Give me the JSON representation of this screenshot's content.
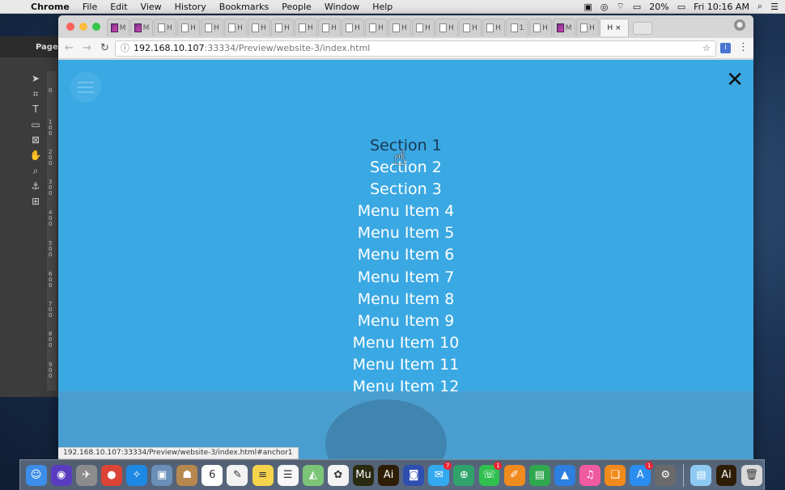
{
  "menubar": {
    "app": "Chrome",
    "items": [
      "File",
      "Edit",
      "View",
      "History",
      "Bookmarks",
      "People",
      "Window",
      "Help"
    ],
    "battery": "20%",
    "clock": "Fri 10:16 AM"
  },
  "photoshop": {
    "page_label": "Page:",
    "ruler_ticks": [
      "0",
      "1\n0\n0",
      "2\n0\n0",
      "3\n0\n0",
      "4\n0\n0",
      "5\n0\n0",
      "6\n0\n0",
      "7\n0\n0",
      "8\n0\n0",
      "9\n0\n0"
    ]
  },
  "browser": {
    "tabs": [
      "M",
      "M",
      "H",
      "H",
      "H",
      "H",
      "H",
      "H",
      "H",
      "H",
      "H",
      "H",
      "H",
      "H",
      "H",
      "H",
      "H",
      "1",
      "H",
      "M",
      "H"
    ],
    "active_tab": "H",
    "url_host": "192.168.10.107",
    "url_rest": ":33334/Preview/website-3/index.html",
    "status_url": "192.168.10.107:33334/Preview/website-3/index.html#anchor1"
  },
  "page": {
    "close_glyph": "✕",
    "menu_items": [
      "Section 1",
      "Section 2",
      "Section 3",
      "Menu Item 4",
      "Menu Item 5",
      "Menu Item 6",
      "Menu Item 7",
      "Menu Item 8",
      "Menu Item 9",
      "Menu Item 10",
      "Menu Item 11",
      "Menu Item 12"
    ],
    "hovered_item": "Section 1"
  },
  "dock": {
    "calendar_day": "6",
    "apps": [
      {
        "name": "finder",
        "glyph": "☺",
        "color": "#3d8ee8"
      },
      {
        "name": "siri",
        "glyph": "◉",
        "color": "#5a3dbf"
      },
      {
        "name": "launchpad",
        "glyph": "✈",
        "color": "#8c8c8c"
      },
      {
        "name": "chrome",
        "glyph": "●",
        "color": "#db4437"
      },
      {
        "name": "safari",
        "glyph": "✧",
        "color": "#1e88e5"
      },
      {
        "name": "preview",
        "glyph": "▣",
        "color": "#6a8fb8"
      },
      {
        "name": "contacts",
        "glyph": "☗",
        "color": "#b6874e"
      },
      {
        "name": "calendar",
        "glyph": "6",
        "color": "#ffffff"
      },
      {
        "name": "textedit",
        "glyph": "✎",
        "color": "#f2f2f2"
      },
      {
        "name": "notes",
        "glyph": "≡",
        "color": "#f5d34b"
      },
      {
        "name": "reminders",
        "glyph": "☰",
        "color": "#f7f7f7"
      },
      {
        "name": "maps",
        "glyph": "◭",
        "color": "#7cc576"
      },
      {
        "name": "photos",
        "glyph": "✿",
        "color": "#f3f3f3"
      },
      {
        "name": "muse",
        "glyph": "Mu",
        "color": "#2a2a10"
      },
      {
        "name": "illustrator",
        "glyph": "Ai",
        "color": "#2e1d05"
      },
      {
        "name": "photo-booth",
        "glyph": "◙",
        "color": "#2f4fb0"
      },
      {
        "name": "messages",
        "glyph": "✉",
        "color": "#33aaf0"
      },
      {
        "name": "browser",
        "glyph": "⊕",
        "color": "#2fa36b"
      },
      {
        "name": "facetime",
        "glyph": "☏",
        "color": "#2fc050"
      },
      {
        "name": "pages",
        "glyph": "✐",
        "color": "#f08c1e"
      },
      {
        "name": "numbers",
        "glyph": "▤",
        "color": "#2fa84f"
      },
      {
        "name": "keynote",
        "glyph": "▲",
        "color": "#2d7fe0"
      },
      {
        "name": "itunes",
        "glyph": "♫",
        "color": "#f05aa0"
      },
      {
        "name": "ibooks",
        "glyph": "❑",
        "color": "#f28a1c"
      },
      {
        "name": "app-store",
        "glyph": "A",
        "color": "#2a8ef0"
      },
      {
        "name": "system-preferences",
        "glyph": "⚙",
        "color": "#6a6a6a"
      }
    ],
    "badges": {
      "messages": "7",
      "facetime": "1",
      "app-store": "1"
    },
    "trailing": [
      {
        "name": "downloads-folder",
        "glyph": "▤",
        "color": "#8ec9f2"
      },
      {
        "name": "illustrator-doc",
        "glyph": "Ai",
        "color": "#2e1d05"
      },
      {
        "name": "trash",
        "glyph": "🗑",
        "color": "#d9d9d9"
      }
    ]
  }
}
